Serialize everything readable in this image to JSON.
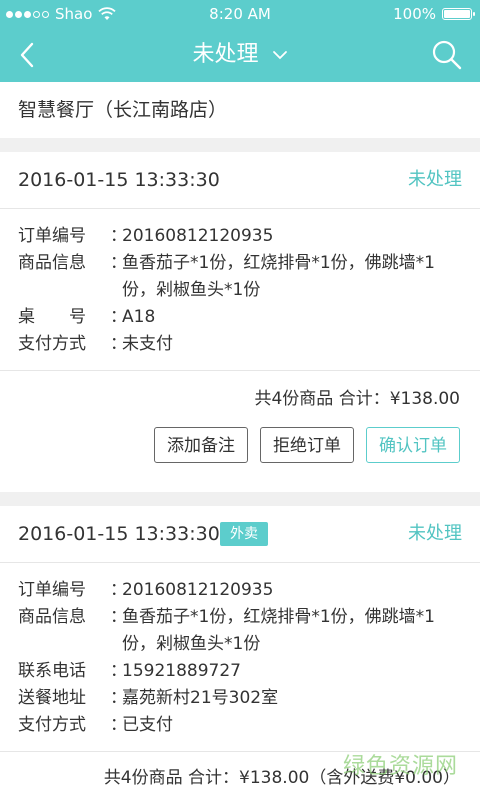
{
  "status_bar": {
    "carrier": "Shao",
    "time": "8:20 AM",
    "battery": "100%"
  },
  "nav": {
    "title": "未处理",
    "back_icon": "chevron-left-icon",
    "search_icon": "search-icon"
  },
  "store": {
    "name": "智慧餐厅（长江南路店）"
  },
  "orders": [
    {
      "time": "2016-01-15 13:33:30",
      "status": "未处理",
      "labels": {
        "order_no": "订单编号",
        "items": "商品信息",
        "table": "桌　　号",
        "payment": "支付方式"
      },
      "colon": "：",
      "order_no": "20160812120935",
      "items_line1": "鱼香茄子*1份，红烧排骨*1份，佛跳墙*1",
      "items_line2": "份，剁椒鱼头*1份",
      "table": "A18",
      "payment": "未支付",
      "total": "共4份商品  合计：¥138.00",
      "buttons": {
        "remark": "添加备注",
        "reject": "拒绝订单",
        "confirm": "确认订单"
      }
    },
    {
      "time": "2016-01-15 13:33:30",
      "tag": "外卖",
      "status": "未处理",
      "labels": {
        "order_no": "订单编号",
        "items": "商品信息",
        "phone": "联系电话",
        "address": "送餐地址",
        "payment": "支付方式"
      },
      "colon": "：",
      "order_no": "20160812120935",
      "items_line1": "鱼香茄子*1份，红烧排骨*1份，佛跳墙*1",
      "items_line2": "份，剁椒鱼头*1份",
      "phone": "15921889727",
      "address": "嘉苑新村21号302室",
      "payment": "已支付",
      "total": "共4份商品  合计：¥138.00（含外送费¥0.00）"
    }
  ],
  "watermark": "绿色资源网",
  "colors": {
    "accent": "#5ccdcc",
    "status_text": "#52c4c2"
  }
}
